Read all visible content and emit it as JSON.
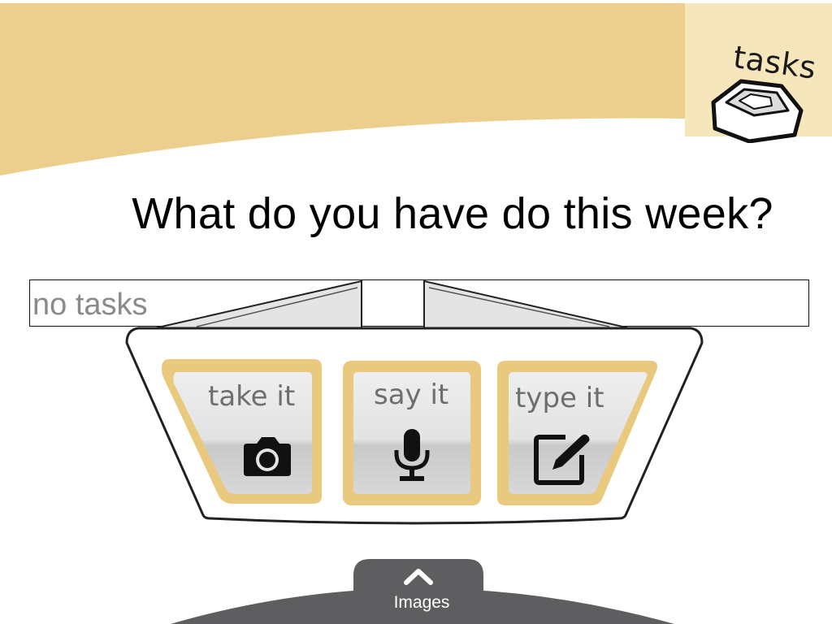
{
  "colors": {
    "header_gold": "#eccf8d",
    "tab_cream": "#f6e6bb",
    "button_border_gold": "#e9c97e",
    "button_face_gray": "#e6e6e6",
    "bottom_bar_gray": "#5e5e60"
  },
  "tasks_tab": {
    "label": "tasks",
    "icon": "inbox-tray-icon"
  },
  "question": "What do you have do this week?",
  "task_field": {
    "value": "no tasks"
  },
  "capture_options": [
    {
      "label": "take it",
      "icon": "camera-icon"
    },
    {
      "label": "say it",
      "icon": "microphone-icon"
    },
    {
      "label": "type it",
      "icon": "edit-note-icon"
    }
  ],
  "bottom_tab": {
    "label": "Images",
    "icon": "chevron-up-icon"
  }
}
